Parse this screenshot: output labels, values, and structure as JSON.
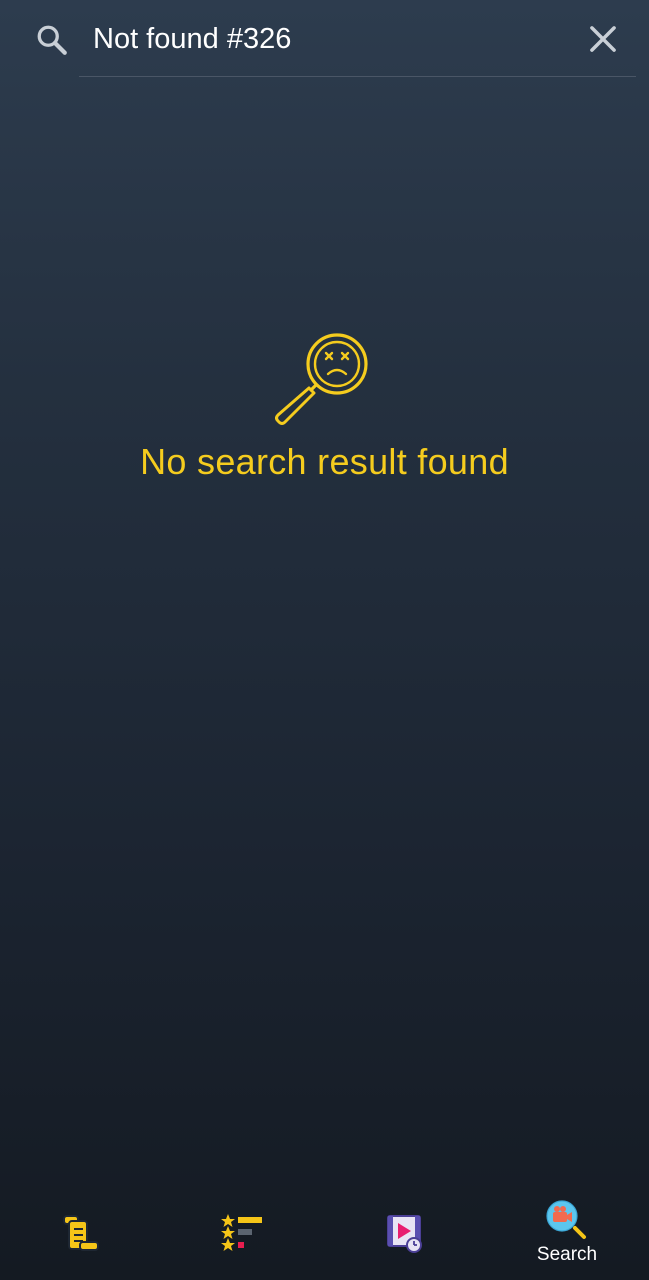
{
  "search": {
    "query": "Not found #326"
  },
  "empty_state": {
    "message": "No search result found",
    "icon": "sad-magnifier-icon",
    "color": "#f5cc1e"
  },
  "bottom_nav": {
    "items": [
      {
        "icon": "scroll-list-icon",
        "label": ""
      },
      {
        "icon": "star-ratings-icon",
        "label": ""
      },
      {
        "icon": "video-schedule-icon",
        "label": ""
      },
      {
        "icon": "camera-search-icon",
        "label": "Search",
        "active": true
      }
    ]
  }
}
